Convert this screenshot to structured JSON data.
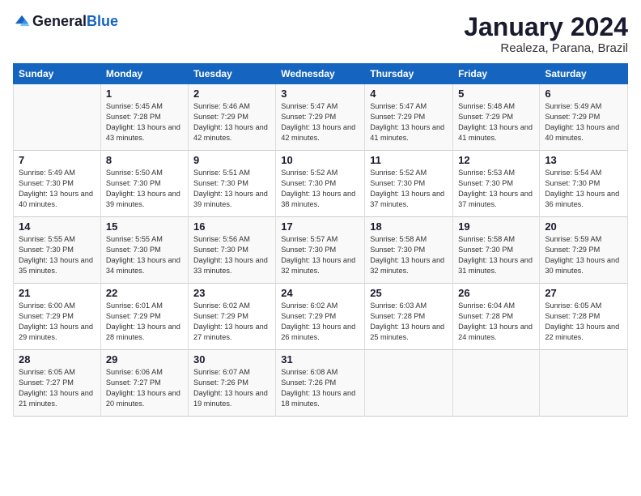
{
  "logo": {
    "general": "General",
    "blue": "Blue"
  },
  "header": {
    "title": "January 2024",
    "subtitle": "Realeza, Parana, Brazil"
  },
  "weekdays": [
    "Sunday",
    "Monday",
    "Tuesday",
    "Wednesday",
    "Thursday",
    "Friday",
    "Saturday"
  ],
  "weeks": [
    [
      {
        "day": "",
        "sunrise": "",
        "sunset": "",
        "daylight": ""
      },
      {
        "day": "1",
        "sunrise": "Sunrise: 5:45 AM",
        "sunset": "Sunset: 7:28 PM",
        "daylight": "Daylight: 13 hours and 43 minutes."
      },
      {
        "day": "2",
        "sunrise": "Sunrise: 5:46 AM",
        "sunset": "Sunset: 7:29 PM",
        "daylight": "Daylight: 13 hours and 42 minutes."
      },
      {
        "day": "3",
        "sunrise": "Sunrise: 5:47 AM",
        "sunset": "Sunset: 7:29 PM",
        "daylight": "Daylight: 13 hours and 42 minutes."
      },
      {
        "day": "4",
        "sunrise": "Sunrise: 5:47 AM",
        "sunset": "Sunset: 7:29 PM",
        "daylight": "Daylight: 13 hours and 41 minutes."
      },
      {
        "day": "5",
        "sunrise": "Sunrise: 5:48 AM",
        "sunset": "Sunset: 7:29 PM",
        "daylight": "Daylight: 13 hours and 41 minutes."
      },
      {
        "day": "6",
        "sunrise": "Sunrise: 5:49 AM",
        "sunset": "Sunset: 7:29 PM",
        "daylight": "Daylight: 13 hours and 40 minutes."
      }
    ],
    [
      {
        "day": "7",
        "sunrise": "Sunrise: 5:49 AM",
        "sunset": "Sunset: 7:30 PM",
        "daylight": "Daylight: 13 hours and 40 minutes."
      },
      {
        "day": "8",
        "sunrise": "Sunrise: 5:50 AM",
        "sunset": "Sunset: 7:30 PM",
        "daylight": "Daylight: 13 hours and 39 minutes."
      },
      {
        "day": "9",
        "sunrise": "Sunrise: 5:51 AM",
        "sunset": "Sunset: 7:30 PM",
        "daylight": "Daylight: 13 hours and 39 minutes."
      },
      {
        "day": "10",
        "sunrise": "Sunrise: 5:52 AM",
        "sunset": "Sunset: 7:30 PM",
        "daylight": "Daylight: 13 hours and 38 minutes."
      },
      {
        "day": "11",
        "sunrise": "Sunrise: 5:52 AM",
        "sunset": "Sunset: 7:30 PM",
        "daylight": "Daylight: 13 hours and 37 minutes."
      },
      {
        "day": "12",
        "sunrise": "Sunrise: 5:53 AM",
        "sunset": "Sunset: 7:30 PM",
        "daylight": "Daylight: 13 hours and 37 minutes."
      },
      {
        "day": "13",
        "sunrise": "Sunrise: 5:54 AM",
        "sunset": "Sunset: 7:30 PM",
        "daylight": "Daylight: 13 hours and 36 minutes."
      }
    ],
    [
      {
        "day": "14",
        "sunrise": "Sunrise: 5:55 AM",
        "sunset": "Sunset: 7:30 PM",
        "daylight": "Daylight: 13 hours and 35 minutes."
      },
      {
        "day": "15",
        "sunrise": "Sunrise: 5:55 AM",
        "sunset": "Sunset: 7:30 PM",
        "daylight": "Daylight: 13 hours and 34 minutes."
      },
      {
        "day": "16",
        "sunrise": "Sunrise: 5:56 AM",
        "sunset": "Sunset: 7:30 PM",
        "daylight": "Daylight: 13 hours and 33 minutes."
      },
      {
        "day": "17",
        "sunrise": "Sunrise: 5:57 AM",
        "sunset": "Sunset: 7:30 PM",
        "daylight": "Daylight: 13 hours and 32 minutes."
      },
      {
        "day": "18",
        "sunrise": "Sunrise: 5:58 AM",
        "sunset": "Sunset: 7:30 PM",
        "daylight": "Daylight: 13 hours and 32 minutes."
      },
      {
        "day": "19",
        "sunrise": "Sunrise: 5:58 AM",
        "sunset": "Sunset: 7:30 PM",
        "daylight": "Daylight: 13 hours and 31 minutes."
      },
      {
        "day": "20",
        "sunrise": "Sunrise: 5:59 AM",
        "sunset": "Sunset: 7:29 PM",
        "daylight": "Daylight: 13 hours and 30 minutes."
      }
    ],
    [
      {
        "day": "21",
        "sunrise": "Sunrise: 6:00 AM",
        "sunset": "Sunset: 7:29 PM",
        "daylight": "Daylight: 13 hours and 29 minutes."
      },
      {
        "day": "22",
        "sunrise": "Sunrise: 6:01 AM",
        "sunset": "Sunset: 7:29 PM",
        "daylight": "Daylight: 13 hours and 28 minutes."
      },
      {
        "day": "23",
        "sunrise": "Sunrise: 6:02 AM",
        "sunset": "Sunset: 7:29 PM",
        "daylight": "Daylight: 13 hours and 27 minutes."
      },
      {
        "day": "24",
        "sunrise": "Sunrise: 6:02 AM",
        "sunset": "Sunset: 7:29 PM",
        "daylight": "Daylight: 13 hours and 26 minutes."
      },
      {
        "day": "25",
        "sunrise": "Sunrise: 6:03 AM",
        "sunset": "Sunset: 7:28 PM",
        "daylight": "Daylight: 13 hours and 25 minutes."
      },
      {
        "day": "26",
        "sunrise": "Sunrise: 6:04 AM",
        "sunset": "Sunset: 7:28 PM",
        "daylight": "Daylight: 13 hours and 24 minutes."
      },
      {
        "day": "27",
        "sunrise": "Sunrise: 6:05 AM",
        "sunset": "Sunset: 7:28 PM",
        "daylight": "Daylight: 13 hours and 22 minutes."
      }
    ],
    [
      {
        "day": "28",
        "sunrise": "Sunrise: 6:05 AM",
        "sunset": "Sunset: 7:27 PM",
        "daylight": "Daylight: 13 hours and 21 minutes."
      },
      {
        "day": "29",
        "sunrise": "Sunrise: 6:06 AM",
        "sunset": "Sunset: 7:27 PM",
        "daylight": "Daylight: 13 hours and 20 minutes."
      },
      {
        "day": "30",
        "sunrise": "Sunrise: 6:07 AM",
        "sunset": "Sunset: 7:26 PM",
        "daylight": "Daylight: 13 hours and 19 minutes."
      },
      {
        "day": "31",
        "sunrise": "Sunrise: 6:08 AM",
        "sunset": "Sunset: 7:26 PM",
        "daylight": "Daylight: 13 hours and 18 minutes."
      },
      {
        "day": "",
        "sunrise": "",
        "sunset": "",
        "daylight": ""
      },
      {
        "day": "",
        "sunrise": "",
        "sunset": "",
        "daylight": ""
      },
      {
        "day": "",
        "sunrise": "",
        "sunset": "",
        "daylight": ""
      }
    ]
  ]
}
